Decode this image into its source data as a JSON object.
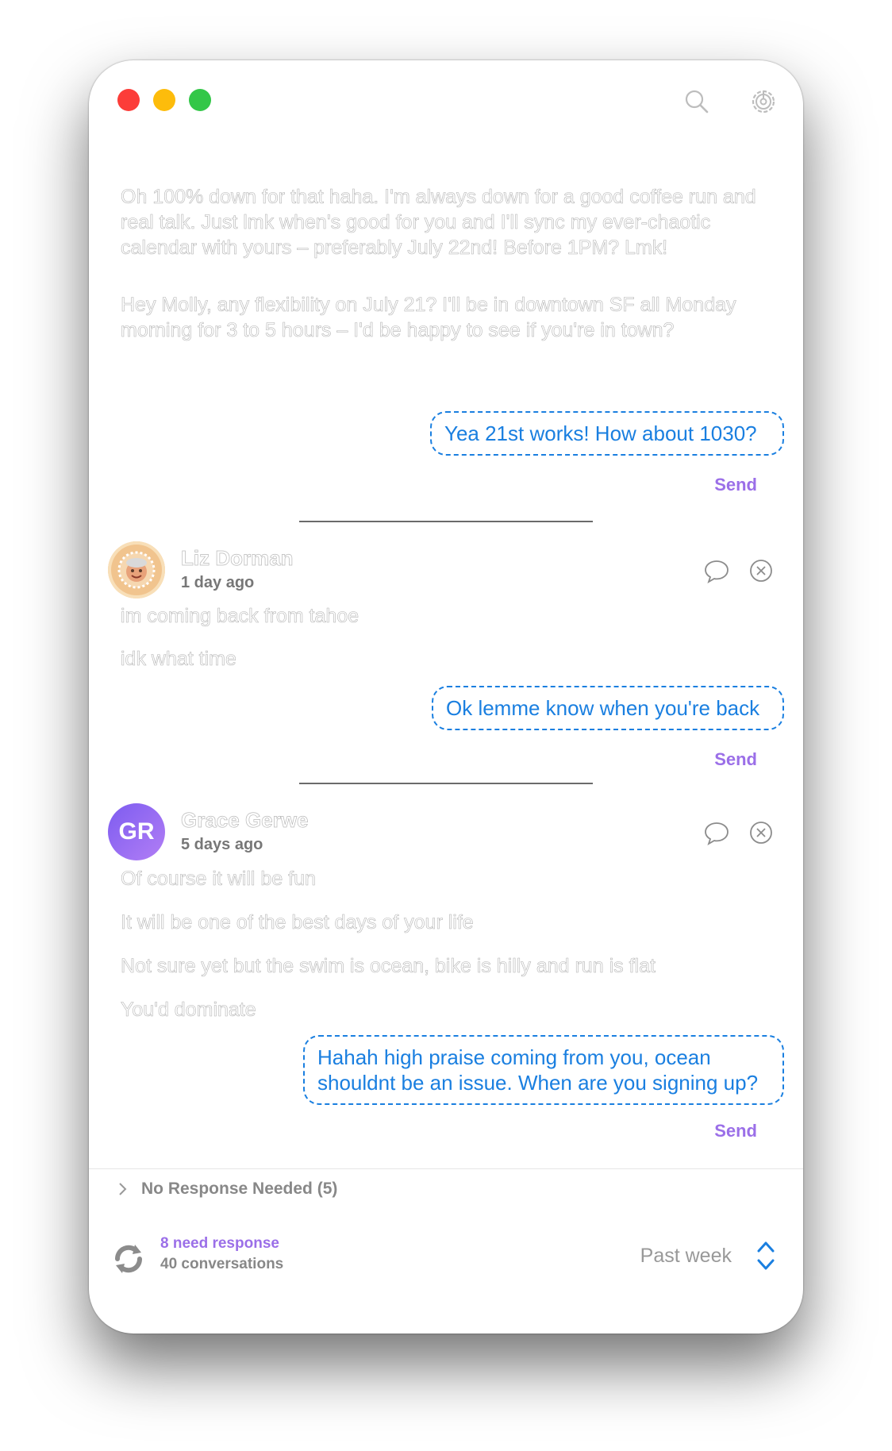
{
  "top_message": {
    "paragraph1": "Oh 100% down for that haha. I'm always down for a good coffee run and real talk. Just lmk when's good for you and I'll sync my ever-chaotic calendar with yours – preferably July 22nd! Before 1PM? Lmk!",
    "paragraph2": "Hey Molly, any flexibility on July 21? I'll be in downtown SF all Monday morning for 3 to 5 hours – I'd be happy to see if you're in town?",
    "reply": "Yea 21st works! How about 1030?",
    "send": "Send"
  },
  "conversations": [
    {
      "name": "Liz Dorman",
      "time": "1 day ago",
      "messages": [
        "im coming back from tahoe",
        "idk what time"
      ],
      "reply": "Ok lemme know when you're back",
      "send": "Send"
    },
    {
      "name": "Grace Gerwe",
      "initials": "GR",
      "time": "5 days ago",
      "messages": [
        "Of course it will be fun",
        "It will be one of the best days of your life",
        "Not sure yet but the swim is ocean, bike is hilly and run is flat",
        "You'd dominate"
      ],
      "reply": "Hahah high praise coming from you, ocean shouldnt be an issue. When are you signing up?",
      "send": "Send"
    }
  ],
  "footer": {
    "no_response": "No Response Needed (5)",
    "need_response": "8 need response",
    "conversations": "40 conversations",
    "period": "Past week"
  },
  "icons": {
    "search": "search-icon",
    "settings": "gear-icon",
    "comment": "comment-icon",
    "dismiss": "close-circle-icon",
    "refresh": "refresh-icon",
    "chevron": "chevron-right-icon",
    "stepper": "up-down-chevron-icon"
  },
  "colors": {
    "accent_blue": "#1a7fe0",
    "accent_purple": "#9b6fe8"
  }
}
